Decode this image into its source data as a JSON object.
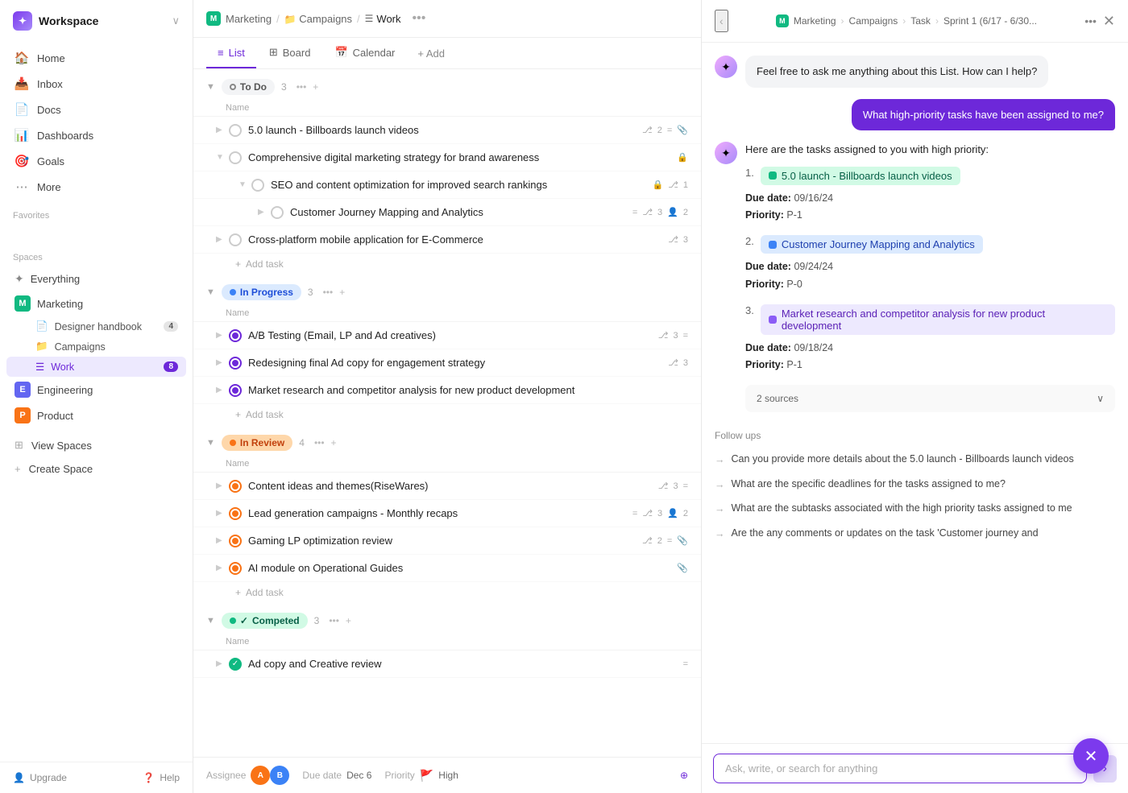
{
  "workspace": {
    "name": "Workspace",
    "logo": "✦"
  },
  "sidebar": {
    "nav": [
      {
        "id": "home",
        "label": "Home",
        "icon": "🏠"
      },
      {
        "id": "inbox",
        "label": "Inbox",
        "icon": "📥"
      },
      {
        "id": "docs",
        "label": "Docs",
        "icon": "📄"
      },
      {
        "id": "dashboards",
        "label": "Dashboards",
        "icon": "📊"
      },
      {
        "id": "goals",
        "label": "Goals",
        "icon": "🎯"
      },
      {
        "id": "more",
        "label": "More",
        "icon": "⋯"
      }
    ],
    "favorites_label": "Favorites",
    "spaces_label": "Spaces",
    "spaces": [
      {
        "id": "everything",
        "label": "Everything",
        "icon": "✦",
        "color": "#888"
      },
      {
        "id": "marketing",
        "label": "Marketing",
        "icon": "M",
        "color": "#10b981"
      },
      {
        "id": "engineering",
        "label": "Engineering",
        "icon": "E",
        "color": "#6366f1"
      },
      {
        "id": "product",
        "label": "Product",
        "icon": "P",
        "color": "#f97316"
      }
    ],
    "marketing_sub": [
      {
        "id": "designer-handbook",
        "label": "Designer handbook",
        "badge": "4"
      },
      {
        "id": "campaigns",
        "label": "Campaigns"
      },
      {
        "id": "work",
        "label": "Work",
        "badge": "8",
        "active": true
      }
    ],
    "view_all": "View Spaces",
    "create": "Create Space",
    "footer": {
      "upgrade": "Upgrade",
      "help": "Help"
    }
  },
  "main": {
    "breadcrumb": [
      "M",
      "Marketing",
      "Campaigns",
      "Work"
    ],
    "tabs": [
      {
        "id": "list",
        "label": "List",
        "icon": "≡",
        "active": true
      },
      {
        "id": "board",
        "label": "Board",
        "icon": "⊞"
      },
      {
        "id": "calendar",
        "label": "Calendar",
        "icon": "📅"
      },
      {
        "id": "add",
        "label": "+ Add"
      }
    ],
    "groups": [
      {
        "id": "todo",
        "label": "To Do",
        "count": 3,
        "style": "todo",
        "tasks": [
          {
            "id": "t1",
            "name": "5.0 launch - Billboards launch videos",
            "subtask_count": 2,
            "has_clip": true,
            "indent": 0
          },
          {
            "id": "t2",
            "name": "Comprehensive digital marketing strategy for brand awareness",
            "has_lock": true,
            "indent": 0,
            "expanded": true
          },
          {
            "id": "t3",
            "name": "SEO and content optimization for improved search rankings",
            "has_lock": true,
            "subtask_count": 1,
            "indent": 1
          },
          {
            "id": "t4",
            "name": "Customer Journey Mapping and Analytics",
            "subtask_count": 3,
            "assignee_count": 2,
            "indent": 2
          },
          {
            "id": "t5",
            "name": "Cross-platform mobile application for E-Commerce",
            "subtask_count": 3,
            "indent": 0
          }
        ],
        "add_label": "Add task"
      },
      {
        "id": "inprogress",
        "label": "In Progress",
        "count": 3,
        "style": "inprogress",
        "tasks": [
          {
            "id": "p1",
            "name": "A/B Testing (Email, LP and Ad creatives)",
            "subtask_count": 3,
            "indent": 0
          },
          {
            "id": "p2",
            "name": "Redesigning final Ad copy for engagement strategy",
            "subtask_count": 3,
            "indent": 0
          },
          {
            "id": "p3",
            "name": "Market research and competitor analysis for new product development",
            "indent": 0
          }
        ],
        "add_label": "Add task"
      },
      {
        "id": "inreview",
        "label": "In Review",
        "count": 4,
        "style": "inreview",
        "tasks": [
          {
            "id": "r1",
            "name": "Content ideas and themes(RiseWares)",
            "subtask_count": 3,
            "indent": 0
          },
          {
            "id": "r2",
            "name": "Lead generation campaigns - Monthly recaps",
            "subtask_count": 3,
            "assignee_count": 2,
            "indent": 0
          },
          {
            "id": "r3",
            "name": "Gaming LP optimization review",
            "subtask_count": 2,
            "has_clip": true,
            "indent": 0
          },
          {
            "id": "r4",
            "name": "AI module on Operational Guides",
            "has_clip": true,
            "indent": 0
          }
        ],
        "add_label": "Add task"
      },
      {
        "id": "completed",
        "label": "Competed",
        "count": 3,
        "style": "completed",
        "tasks": [
          {
            "id": "c1",
            "name": "Ad copy and Creative review",
            "indent": 0
          }
        ],
        "add_label": "Add task"
      }
    ],
    "col_name": "Name"
  },
  "ai_panel": {
    "breadcrumb": [
      "M",
      "Marketing",
      "Campaigns",
      "Task",
      "Sprint 1 (6/17 - 6/30..."
    ],
    "initial_message": "Feel free to ask me anything about this List. How can I help?",
    "user_query": "What high-priority tasks have been assigned to me?",
    "response_intro": "Here are the tasks assigned to you with high priority:",
    "tasks": [
      {
        "num": "1.",
        "name": "5.0 launch - Billboards launch videos",
        "style": "green",
        "due": "09/16/24",
        "priority": "P-1"
      },
      {
        "num": "2.",
        "name": "Customer Journey Mapping and Analytics",
        "style": "blue",
        "due": "09/24/24",
        "priority": "P-0"
      },
      {
        "num": "3.",
        "name": "Market research and competitor analysis for new product development",
        "style": "purple",
        "due": "09/18/24",
        "priority": "P-1"
      }
    ],
    "sources": "2 sources",
    "follow_ups_label": "Follow ups",
    "follow_ups": [
      "Can you provide more details about the 5.0 launch - Billboards launch videos",
      "What are the specific deadlines for the tasks assigned to me?",
      "What are the subtasks associated with the high priority tasks assigned to me",
      "Are the any comments or updates on the task 'Customer journey and"
    ],
    "input_placeholder": "Ask, write, or search for anything"
  },
  "bottom_bar": {
    "assignee_label": "Assignee",
    "due_date_label": "Due date",
    "due_date_value": "Dec 6",
    "priority_label": "Priority",
    "priority_value": "High"
  }
}
